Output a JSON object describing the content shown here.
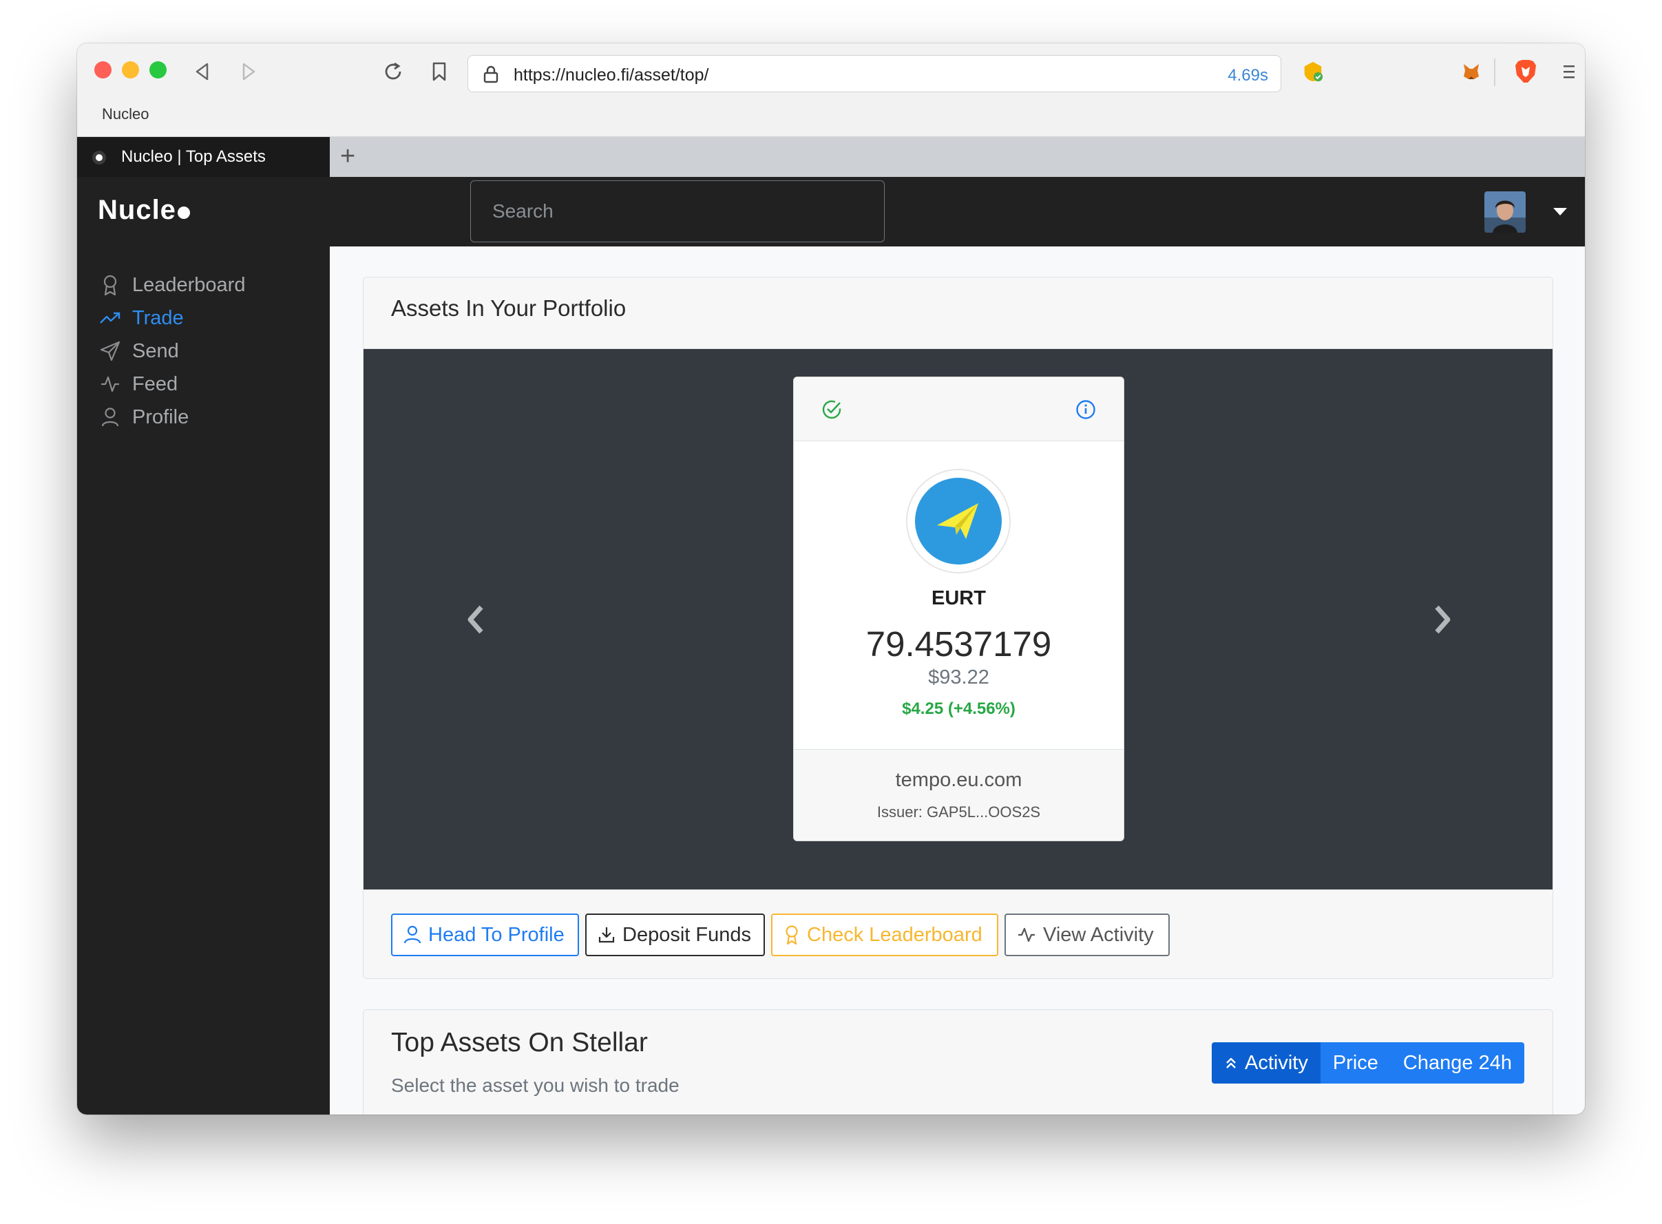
{
  "browser": {
    "url": "https://nucleo.fi/asset/top/",
    "load_time": "4.69s",
    "bookmark": "Nucleo",
    "tab_title": "Nucleo | Top Assets",
    "new_tab": "+"
  },
  "navbar": {
    "brand": "Nucle",
    "search_placeholder": "Search"
  },
  "sidebar": {
    "items": [
      {
        "label": "Leaderboard",
        "icon": "award-icon",
        "active": false
      },
      {
        "label": "Trade",
        "icon": "trending-up-icon",
        "active": true
      },
      {
        "label": "Send",
        "icon": "send-icon",
        "active": false
      },
      {
        "label": "Feed",
        "icon": "activity-icon",
        "active": false
      },
      {
        "label": "Profile",
        "icon": "user-icon",
        "active": false
      }
    ]
  },
  "portfolio": {
    "title": "Assets In Your Portfolio",
    "asset": {
      "code": "EURT",
      "balance": "79.4537179",
      "usd_value": "$93.22",
      "change": "$4.25 (+4.56%)",
      "domain": "tempo.eu.com",
      "issuer": "Issuer: GAP5L...OOS2S"
    },
    "actions": {
      "profile": "Head To Profile",
      "deposit": "Deposit Funds",
      "leaderboard": "Check Leaderboard",
      "activity": "View Activity"
    }
  },
  "top_assets": {
    "title": "Top Assets On Stellar",
    "subtitle": "Select the asset you wish to trade",
    "sort": {
      "activity": "Activity",
      "price": "Price",
      "change": "Change 24h"
    }
  },
  "colors": {
    "primary": "#1f7cf2",
    "success": "#28a745",
    "warning": "#f7b731",
    "dark": "#212121",
    "carousel": "#343a40"
  }
}
